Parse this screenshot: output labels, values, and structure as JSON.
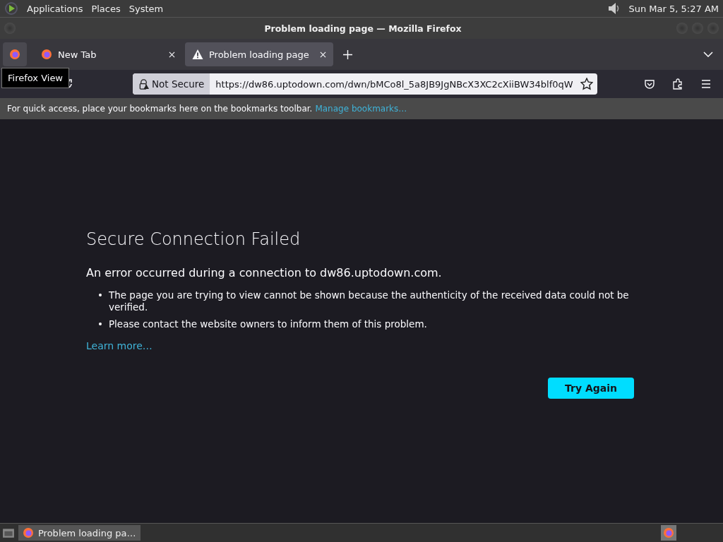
{
  "top_panel": {
    "menus": [
      "Applications",
      "Places",
      "System"
    ],
    "clock": "Sun Mar  5,  5:27 AM"
  },
  "window": {
    "title": "Problem loading page — Mozilla Firefox"
  },
  "tabs": [
    {
      "label": "New Tab",
      "kind": "firefox",
      "selected": false
    },
    {
      "label": "Problem loading page",
      "kind": "warning",
      "selected": true
    }
  ],
  "tooltip": "Firefox View",
  "url_bar": {
    "security": "Not Secure",
    "url": "https://dw86.uptodown.com/dwn/bMCo8l_5a8JB9JgNBcX3XC2cXiiBW34blf0qW"
  },
  "bookmarks_bar": {
    "message": "For quick access, place your bookmarks here on the bookmarks toolbar.",
    "link": "Manage bookmarks…"
  },
  "error": {
    "title": "Secure Connection Failed",
    "subtitle": "An error occurred during a connection to dw86.uptodown.com.",
    "bullets": [
      {
        "marker": "•",
        "text": "The page you are trying to view cannot be shown because the authenticity of the received data could not be verified."
      },
      {
        "marker": "•",
        "text": "Please contact the website owners to inform them of this problem."
      }
    ],
    "learn_more": "Learn more…",
    "button": "Try Again"
  },
  "taskbar": {
    "items": [
      {
        "label": "Problem loading pa…",
        "selected": true
      }
    ]
  }
}
